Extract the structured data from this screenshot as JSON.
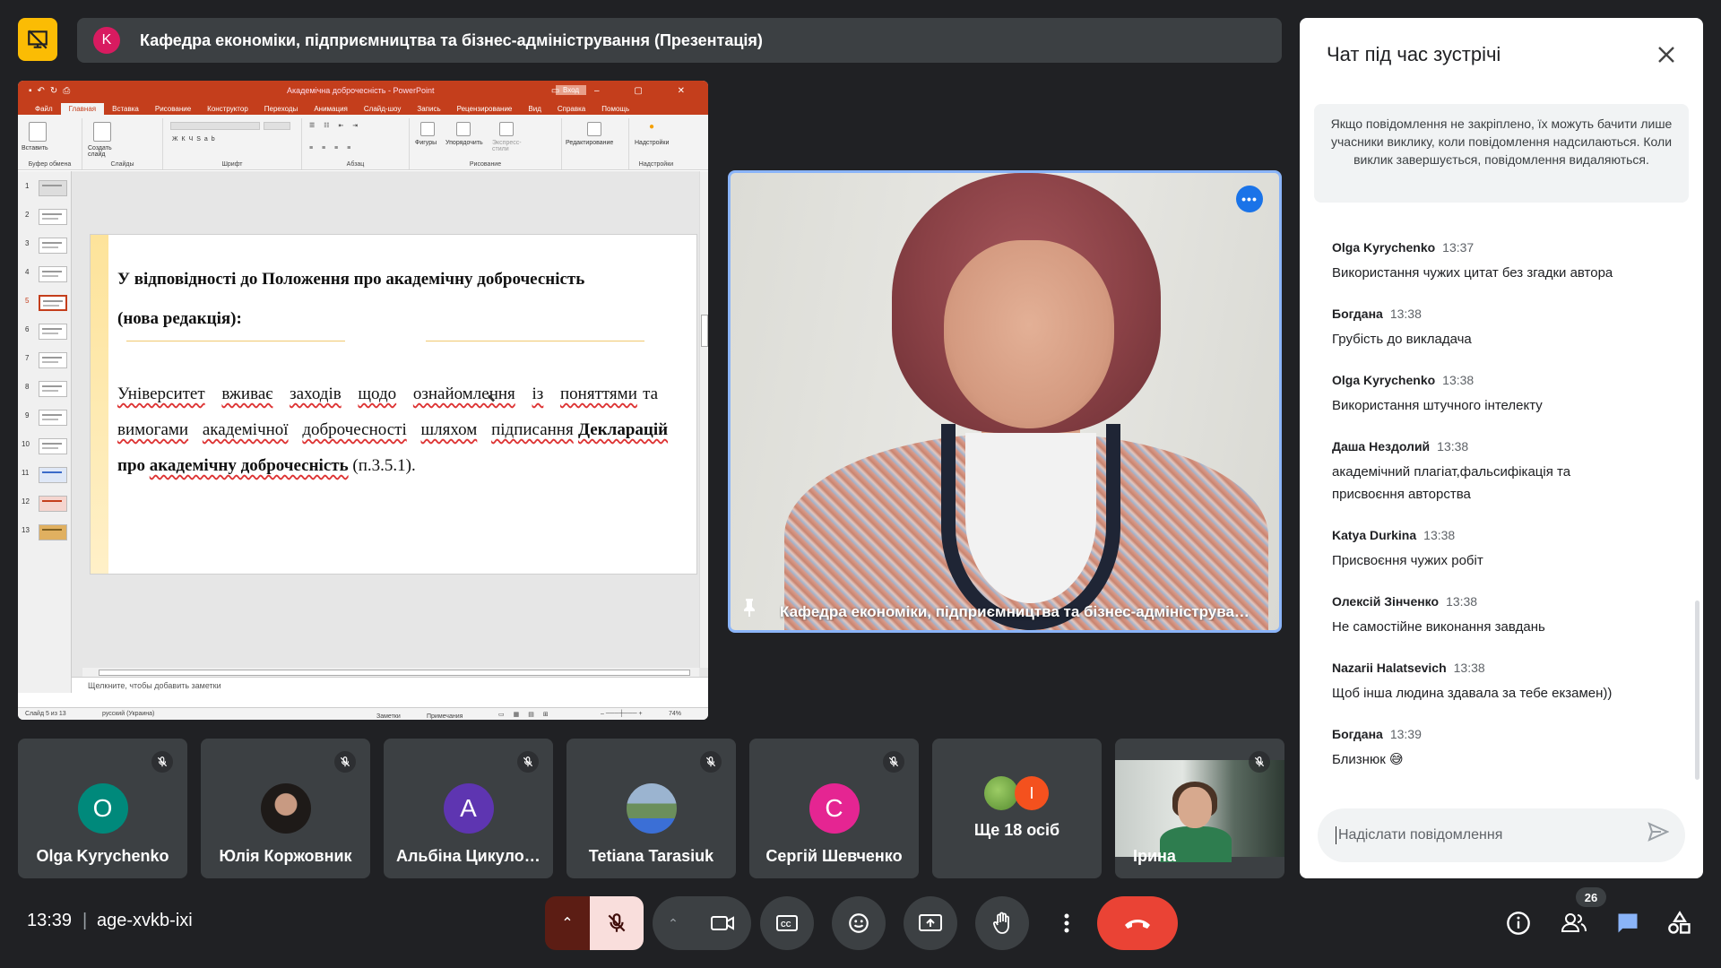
{
  "meeting": {
    "title": "Кафедра економіки, підприємництва та бізнес-адміністрування (Презентація)",
    "title_avatar_letter": "K",
    "clock": "13:39",
    "separator": "|",
    "code": "age-xvkb-ixi",
    "participant_count": "26"
  },
  "presentation": {
    "app_title": "Академічна доброчесність - PowerPoint",
    "signin": "Вход",
    "menu": [
      "Файл",
      "Главная",
      "Вставка",
      "Рисование",
      "Конструктор",
      "Переходы",
      "Анимация",
      "Слайд-шоу",
      "Запись",
      "Рецензирование",
      "Вид",
      "Справка",
      "Помощь"
    ],
    "ribbon_groups": [
      "Буфер обмена",
      "Слайды",
      "Шрифт",
      "Абзац",
      "Рисование",
      "",
      "Надстройки"
    ],
    "ribbon_buttons": {
      "paste": "Вставить",
      "new_slide": "Создать слайд",
      "shapes": "Фигуры",
      "arrange": "Упорядочить",
      "express": "Экспресс-стили",
      "editing": "Редактирование",
      "addins": "Надстройки"
    },
    "slide_numbers": [
      "1",
      "2",
      "3",
      "4",
      "5",
      "6",
      "7",
      "8",
      "9",
      "10",
      "11",
      "12",
      "13"
    ],
    "selected_slide": 5,
    "slide": {
      "heading_line1": "У відповідності до Положення про академічну доброчесність",
      "heading_line2": "(нова редакція):",
      "para_parts": {
        "w1": "Університет",
        "w2": "вживає",
        "w3": "заходів",
        "w4": "щодо",
        "w5": "ознайомлення",
        "w6": "із",
        "w7": "поняттями",
        "w8": "та",
        "w9": "вимогами",
        "w10": "академічної",
        "w11": "доброчесності",
        "w12": "шляхом",
        "w13": "підписання",
        "w14": "Декларацій",
        "w15": "про",
        "w16": "академічну доброчесність",
        "w17": "(п.3.5.1)."
      }
    },
    "notes_placeholder": "Щелкните, чтобы добавить заметки",
    "status": {
      "slide_of": "Слайд 5 из 13",
      "language": "русский (Украина)",
      "notes": "Заметки",
      "comments": "Примечания",
      "zoom": "74%"
    }
  },
  "speaker": {
    "name": "Кафедра економіки, підприємництва та бізнес-адміністрування (Презентація)",
    "more_label": "•••"
  },
  "participants": [
    {
      "name": "Olga Kyrychenko",
      "initial": "O",
      "color": "#00897b",
      "type": "letter"
    },
    {
      "name": "Юлія Коржовник",
      "initial": "",
      "color": "#2a2a2a",
      "type": "photo"
    },
    {
      "name": "Альбіна Цикулова",
      "initial": "A",
      "color": "#5e35b1",
      "type": "letter"
    },
    {
      "name": "Tetiana Tarasiuk",
      "initial": "",
      "color": "#7a8ea6",
      "type": "photo"
    },
    {
      "name": "Сергій Шевченко",
      "initial": "C",
      "color": "#e52592",
      "type": "letter"
    }
  ],
  "more_people": {
    "label": "Ще 18 осіб",
    "second_initial": "I"
  },
  "video_participant": {
    "name": "Ірина"
  },
  "chat": {
    "title": "Чат під час зустрічі",
    "info": "Якщо повідомлення не закріплено, їх можуть бачити лише учасники виклику, коли повідомлення надсилаються. Коли виклик завершується, повідомлення видаляються.",
    "messages": [
      {
        "who": "Olga Kyrychenko",
        "time": "13:37",
        "text": "Використання чужих цитат без згадки автора"
      },
      {
        "who": "Богдана",
        "time": "13:38",
        "text": "Грубість до викладача"
      },
      {
        "who": "Olga Kyrychenko",
        "time": "13:38",
        "text": "Використання штучного інтелекту"
      },
      {
        "who": "Даша Нездолий",
        "time": "13:38",
        "text": "академічний плагіат,фальсифікація та присвоєння авторства"
      },
      {
        "who": "Katya Durkina",
        "time": "13:38",
        "text": "Присвоєння чужих робіт"
      },
      {
        "who": "Олексій Зінченко",
        "time": "13:38",
        "text": "Не самостійне виконання завдань"
      },
      {
        "who": "Nazarii Halatsevich",
        "time": "13:38",
        "text": "Щоб інша людина здавала за тебе екзамен))"
      },
      {
        "who": "Богдана",
        "time": "13:39",
        "text": "Близнюк 😅"
      }
    ],
    "input_placeholder": "Надіслати повідомлення"
  },
  "colors": {
    "background": "#202124",
    "surface": "#3c4043",
    "accent_blue": "#8ab4f8",
    "end_call": "#ea4335",
    "present_yellow": "#fbbc04",
    "powerpoint": "#c43e1c"
  }
}
